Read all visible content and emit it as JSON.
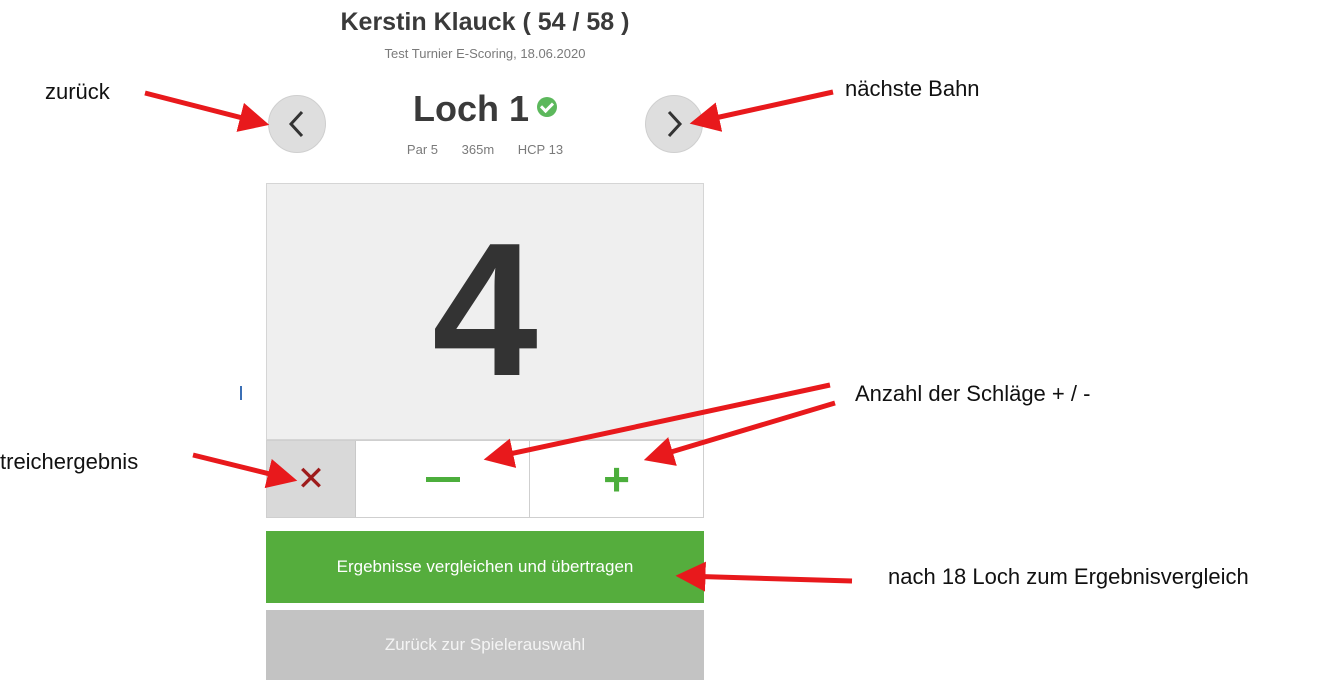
{
  "header": {
    "player_name": "Kerstin Klauck ( 54 / 58 )",
    "subtitle": "Test Turnier E-Scoring, 18.06.2020"
  },
  "hole": {
    "title": "Loch 1",
    "par": "Par 5",
    "length": "365m",
    "hcp": "HCP 13",
    "status_icon": "check-circle-icon"
  },
  "score": {
    "value": "4"
  },
  "controls": {
    "strike_icon": "x-icon",
    "minus_icon": "minus-icon",
    "plus_icon": "plus-icon",
    "plus_label": "+"
  },
  "buttons": {
    "compare": "Ergebnisse vergleichen und übertragen",
    "back": "Zurück zur Spielerauswahl"
  },
  "annotations": {
    "zurueck": "zurück",
    "naechste_bahn": "nächste Bahn",
    "anzahl": "Anzahl der Schläge + / -",
    "streich": "treichergebnis",
    "nach18": "nach 18 Loch zum Ergebnisvergleich"
  },
  "colors": {
    "accent_green": "#55ad3d",
    "strike_red": "#9e1b1b",
    "arrow_red": "#e8191c"
  }
}
